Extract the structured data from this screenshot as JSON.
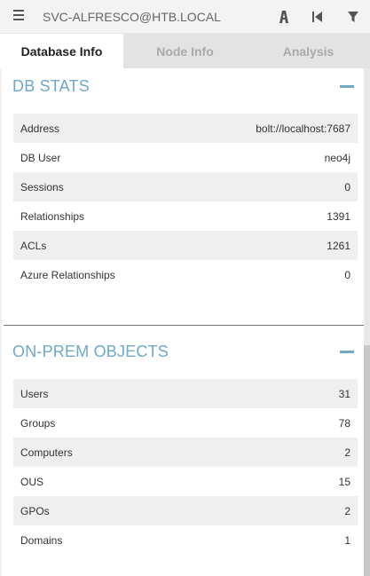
{
  "header": {
    "search_value": "SVC-ALFRESCO@HTB.LOCAL",
    "icons": [
      "menu-icon",
      "path-icon",
      "back-icon",
      "filter-icon"
    ]
  },
  "tabs": [
    {
      "label": "Database Info",
      "active": true
    },
    {
      "label": "Node Info",
      "active": false
    },
    {
      "label": "Analysis",
      "active": false
    }
  ],
  "db_stats": {
    "title": "DB STATS",
    "rows": [
      {
        "label": "Address",
        "value": "bolt://localhost:7687"
      },
      {
        "label": "DB User",
        "value": "neo4j"
      },
      {
        "label": "Sessions",
        "value": "0"
      },
      {
        "label": "Relationships",
        "value": "1391"
      },
      {
        "label": "ACLs",
        "value": "1261"
      },
      {
        "label": "Azure Relationships",
        "value": "0"
      }
    ]
  },
  "onprem": {
    "title": "ON-PREM OBJECTS",
    "rows": [
      {
        "label": "Users",
        "value": "31"
      },
      {
        "label": "Groups",
        "value": "78"
      },
      {
        "label": "Computers",
        "value": "2"
      },
      {
        "label": "OUS",
        "value": "15"
      },
      {
        "label": "GPOs",
        "value": "2"
      },
      {
        "label": "Domains",
        "value": "1"
      }
    ]
  },
  "colors": {
    "accent": "#6fa8c8",
    "row_alt": "#efefef",
    "tab_inactive": "#e3e3e3"
  }
}
